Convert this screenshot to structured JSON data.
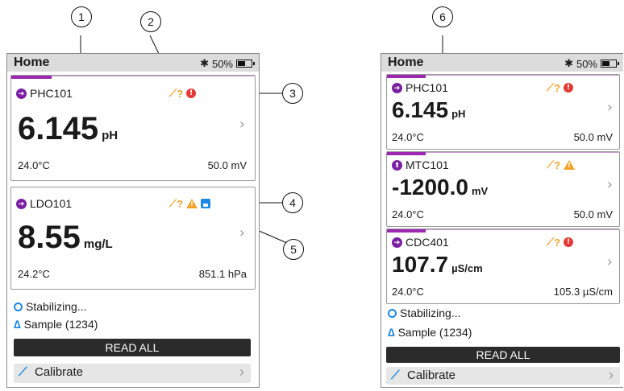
{
  "callouts": [
    "1",
    "2",
    "3",
    "4",
    "5",
    "6"
  ],
  "left": {
    "status": {
      "title": "Home",
      "bt": "✱",
      "battery": "50%"
    },
    "cards": [
      {
        "probe": "PHC101",
        "value": "6.145",
        "unit": "pH",
        "foot_left": "24.0°C",
        "foot_right": "50.0 mV",
        "cal": "?",
        "status": "error",
        "progress": 0.3
      },
      {
        "probe": "LDO101",
        "value": "8.55",
        "unit": "mg/L",
        "foot_left": "24.2°C",
        "foot_right": "851.1 hPa",
        "cal": "?",
        "status": "warning",
        "progress": 0
      }
    ],
    "stabilizing": "Stabilizing...",
    "sample": "Sample (1234)",
    "read_all": "READ ALL",
    "calibrate": "Calibrate"
  },
  "right": {
    "status": {
      "title": "Home",
      "bt": "✱",
      "battery": "50%"
    },
    "cards": [
      {
        "probe": "PHC101",
        "value": "6.145",
        "unit": "pH",
        "foot_left": "24.0°C",
        "foot_right": "50.0 mV",
        "cal": "?",
        "status": "error",
        "progress": 0.17
      },
      {
        "probe": "MTC101",
        "value": "-1200.0",
        "unit": "mV",
        "foot_left": "24.0°C",
        "foot_right": "50.0 mV",
        "cal": "?",
        "status": "warning",
        "progress": 0.17
      },
      {
        "probe": "CDC401",
        "value": "107.7",
        "unit": "µS/cm",
        "foot_left": "24.0°C",
        "foot_right": "105.3 µS/cm",
        "cal": "?",
        "status": "error",
        "progress": 0.17
      }
    ],
    "stabilizing": "Stabilizing...",
    "sample": "Sample (1234)",
    "read_all": "READ ALL",
    "calibrate": "Calibrate"
  },
  "colors": {
    "accent": "#9c27b0",
    "error": "#e53935",
    "warning": "#f2a32c",
    "info": "#1e88e5"
  }
}
